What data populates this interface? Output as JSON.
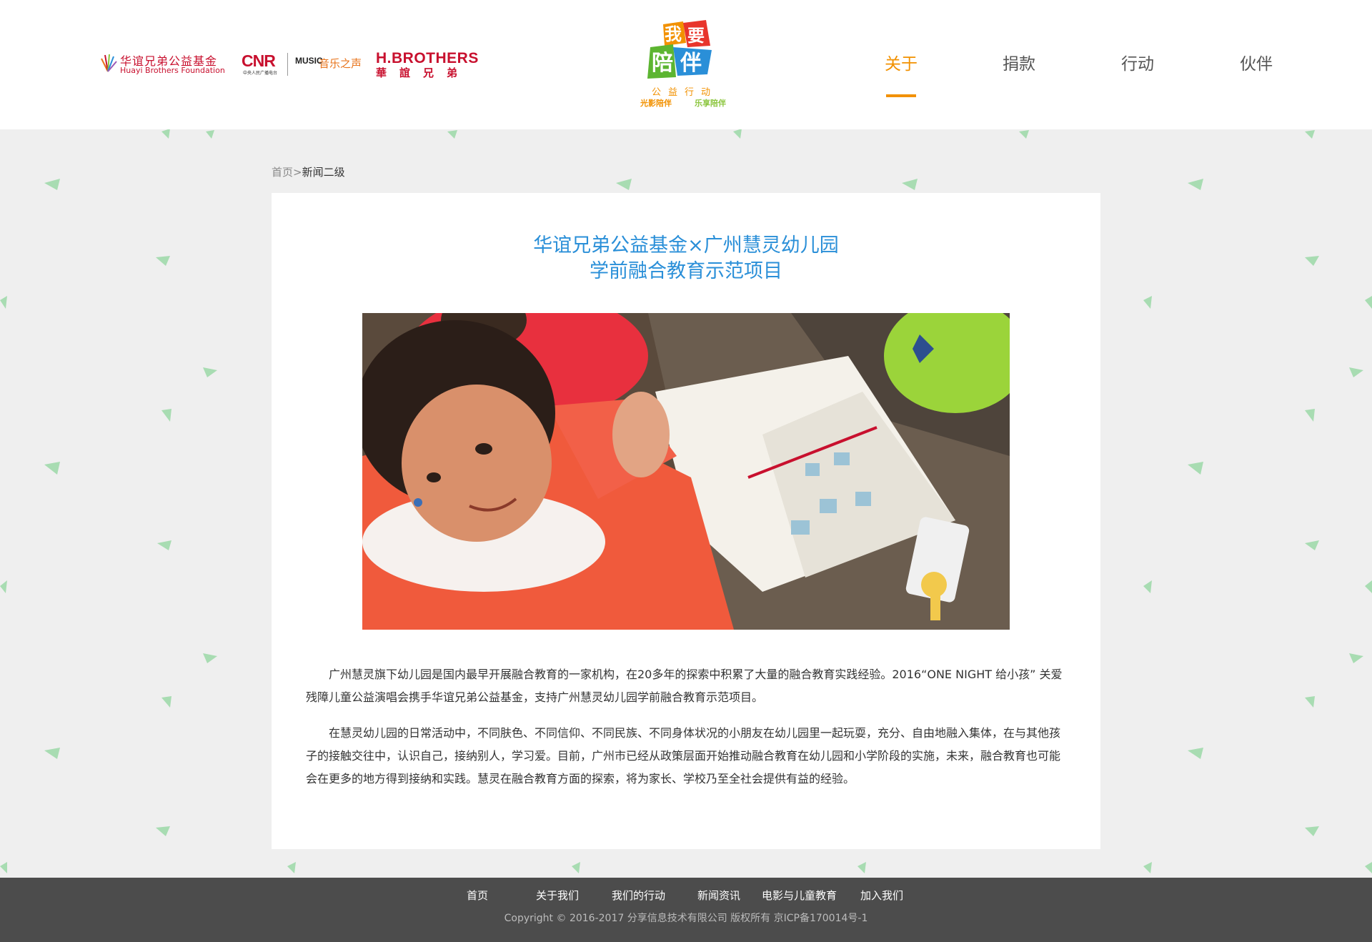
{
  "header": {
    "logos": {
      "huayi_cn": "华谊兄弟公益基金",
      "huayi_en": "Huayi Brothers Foundation",
      "cnr": "CNR",
      "cnr_sub": "中央人民广播电台",
      "music": "MUSIC",
      "music_voice": "音乐之声",
      "hbro_en": "H.BROTHERS",
      "hbro_cn": "華誼兄弟"
    },
    "center_logo": {
      "main": [
        "我",
        "要",
        "陪",
        "伴"
      ],
      "sub": "公益行动",
      "tag1": "光影陪伴",
      "tag2": "乐享陪伴"
    },
    "nav": [
      {
        "label": "关于",
        "active": true
      },
      {
        "label": "捐款",
        "active": false
      },
      {
        "label": "行动",
        "active": false
      },
      {
        "label": "伙伴",
        "active": false
      }
    ],
    "accent_color": "#f29100"
  },
  "breadcrumb": {
    "home": "首页",
    "separator": ">",
    "current": "新闻二级"
  },
  "article": {
    "title_line1": "华谊兄弟公益基金×广州慧灵幼儿园",
    "title_line2": "学前融合教育示范项目",
    "title_color": "#2a8fd8",
    "paragraphs": [
      "广州慧灵旗下幼儿园是国内最早开展融合教育的一家机构，在20多年的探索中积累了大量的融合教育实践经验。2016“ONE NIGHT 给小孩” 关爱残障儿童公益演唱会携手华谊兄弟公益基金，支持广州慧灵幼儿园学前融合教育示范项目。",
      "在慧灵幼儿园的日常活动中，不同肤色、不同信仰、不同民族、不同身体状况的小朋友在幼儿园里一起玩耍，充分、自由地融入集体，在与其他孩子的接触交往中，认识自己，接纳别人，学习爱。目前，广州市已经从政策层面开始推动融合教育在幼儿园和小学阶段的实施，未来，融合教育也可能会在更多的地方得到接纳和实践。慧灵在融合教育方面的探索，将为家长、学校乃至全社会提供有益的经验。"
    ]
  },
  "footer": {
    "links": [
      "首页",
      "关于我们",
      "我们的行动",
      "新闻资讯",
      "电影与儿童教育",
      "加入我们"
    ],
    "copyright": "Copyright © 2016-2017 分享信息技术有限公司 版权所有    京ICP备170014号-1"
  }
}
